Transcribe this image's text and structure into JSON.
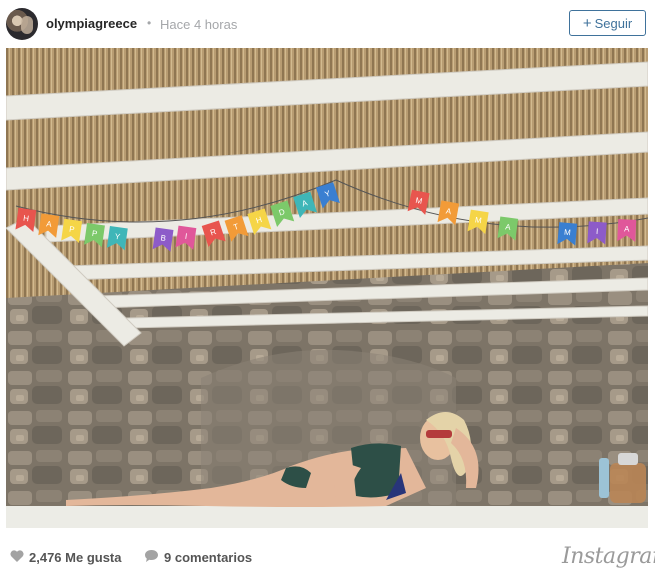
{
  "header": {
    "username": "olympiagreece",
    "separator": "•",
    "time": "Hace 4 horas",
    "follow_label": "Seguir",
    "follow_plus": "+"
  },
  "photo": {
    "banner_left": [
      "H",
      "A",
      "P",
      "P",
      "Y",
      "",
      "B",
      "I",
      "R",
      "T",
      "H",
      "D",
      "A",
      "Y"
    ],
    "banner_right": [
      "M",
      "A",
      "M",
      "A",
      "",
      "M",
      "I",
      "A"
    ]
  },
  "footer": {
    "likes": "2,476 Me gusta",
    "comments": "9 comentarios",
    "brand": "Instagram"
  },
  "colors": {
    "follow_blue": "#3f729b",
    "muted_text": "#a5a7aa",
    "footer_text": "#555555"
  },
  "icons": {
    "like": "heart-icon",
    "comment": "comment-bubble-icon"
  }
}
